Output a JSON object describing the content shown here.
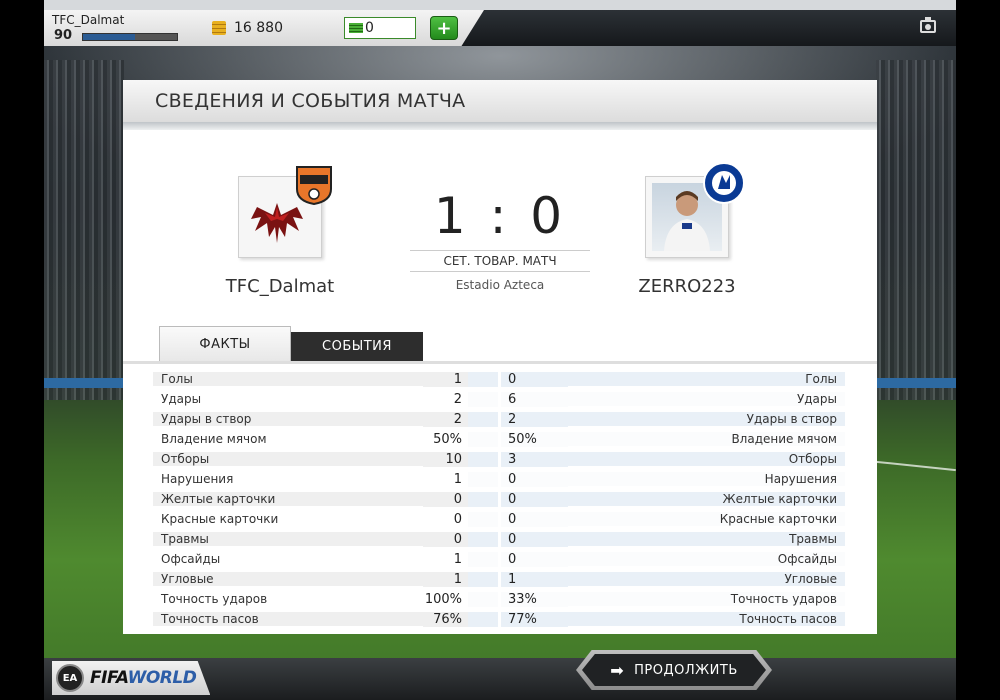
{
  "user": {
    "name": "TFC_Dalmat",
    "level": "90",
    "xp_progress": 0.55
  },
  "currency": {
    "coins": "16 880",
    "fifa_points": "0"
  },
  "panel": {
    "title": "СВЕДЕНИЯ И СОБЫТИЯ МАТЧА"
  },
  "match": {
    "home_team": "TFC_Dalmat",
    "away_team": "ZERRO223",
    "score": "1 : 0",
    "type": "СЕТ. ТОВАР. МАТЧ",
    "venue": "Estadio Azteca"
  },
  "tabs": {
    "facts": "ФАКТЫ",
    "events": "СОБЫТИЯ"
  },
  "stats": [
    {
      "label": "Голы",
      "home": "1",
      "away": "0"
    },
    {
      "label": "Удары",
      "home": "2",
      "away": "6"
    },
    {
      "label": "Удары в створ",
      "home": "2",
      "away": "2"
    },
    {
      "label": "Владение мячом",
      "home": "50%",
      "away": "50%"
    },
    {
      "label": "Отборы",
      "home": "10",
      "away": "3"
    },
    {
      "label": "Нарушения",
      "home": "1",
      "away": "0"
    },
    {
      "label": "Желтые карточки",
      "home": "0",
      "away": "0"
    },
    {
      "label": "Красные карточки",
      "home": "0",
      "away": "0"
    },
    {
      "label": "Травмы",
      "home": "0",
      "away": "0"
    },
    {
      "label": "Офсайды",
      "home": "1",
      "away": "0"
    },
    {
      "label": "Угловые",
      "home": "1",
      "away": "1"
    },
    {
      "label": "Точность ударов",
      "home": "100%",
      "away": "33%"
    },
    {
      "label": "Точность пасов",
      "home": "76%",
      "away": "77%"
    }
  ],
  "footer": {
    "logo_fifa": "FIFA",
    "logo_world": "WORLD",
    "ea_label": "EA",
    "continue_label": "ПРОДОЛЖИТЬ"
  },
  "colors": {
    "accent_green": "#2f9e27",
    "xp_blue": "#2b5c94",
    "dark_tab": "#2d2d2d"
  }
}
